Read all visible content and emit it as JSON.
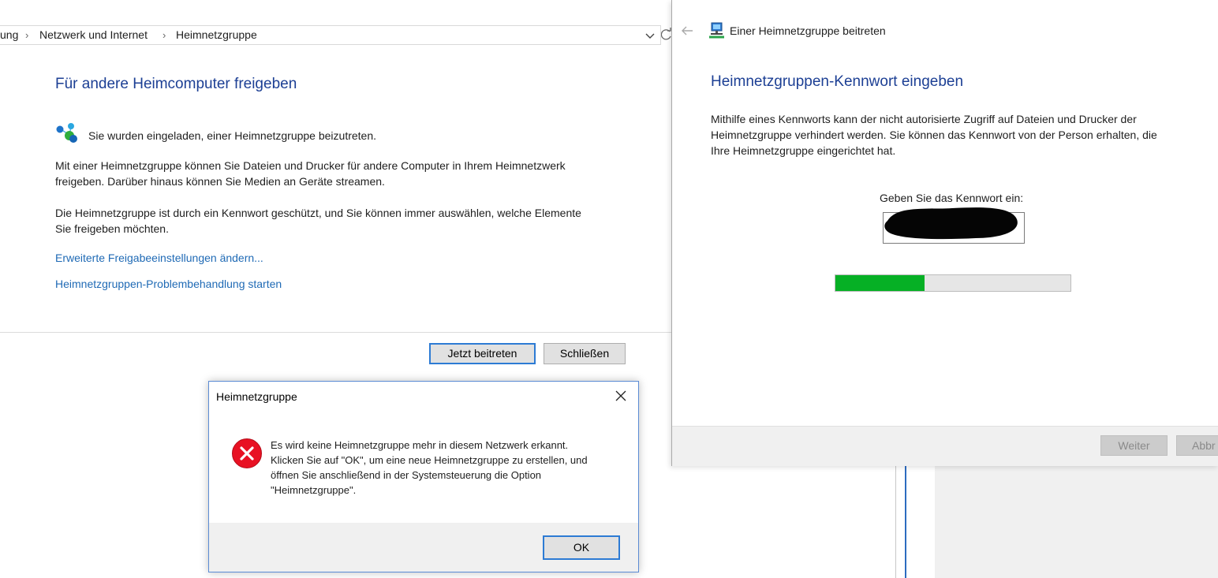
{
  "control_panel": {
    "breadcrumb": [
      "ung",
      "Netzwerk und Internet",
      "Heimnetzgruppe"
    ],
    "title": "Für andere Heimcomputer freigeben",
    "invited_text": "Sie wurden eingeladen, einer Heimnetzgruppe beizutreten.",
    "paragraph1_line1": "Mit einer Heimnetzgruppe können Sie Dateien und Drucker für andere Computer in Ihrem Heimnetzwerk",
    "paragraph1_line2": "freigeben. Darüber hinaus können Sie Medien an Geräte streamen.",
    "paragraph2_line1": "Die Heimnetzgruppe ist durch ein Kennwort geschützt, und Sie können immer auswählen, welche Elemente",
    "paragraph2_line2": "Sie freigeben möchten.",
    "link_advanced": "Erweiterte Freigabeeinstellungen ändern...",
    "link_troubleshoot": "Heimnetzgruppen-Problembehandlung starten",
    "join_button": "Jetzt beitreten",
    "close_button": "Schließen"
  },
  "wizard": {
    "window_title": "Einer Heimnetzgruppe beitreten",
    "heading": "Heimnetzgruppen-Kennwort eingeben",
    "desc_line1": "Mithilfe eines Kennworts kann der nicht autorisierte Zugriff auf Dateien und Drucker der",
    "desc_line2": "Heimnetzgruppe verhindert werden. Sie können das Kennwort von der Person erhalten, die",
    "desc_line3": "Ihre Heimnetzgruppe eingerichtet hat.",
    "password_label": "Geben Sie das Kennwort ein:",
    "progress": 0.38,
    "next_button": "Weiter",
    "cancel_button": "Abbr",
    "progress_color": "#06b025"
  },
  "error_dialog": {
    "title": "Heimnetzgruppe",
    "message_line1": "Es wird keine Heimnetzgruppe mehr in diesem Netzwerk erkannt.",
    "message_line2": "Klicken Sie auf \"OK\", um eine neue Heimnetzgruppe zu erstellen, und",
    "message_line3": "öffnen Sie anschließend in der Systemsteuerung die Option",
    "message_line4": "\"Heimnetzgruppe\".",
    "ok_button": "OK",
    "icon": "error-icon",
    "icon_color": "#e81123"
  }
}
